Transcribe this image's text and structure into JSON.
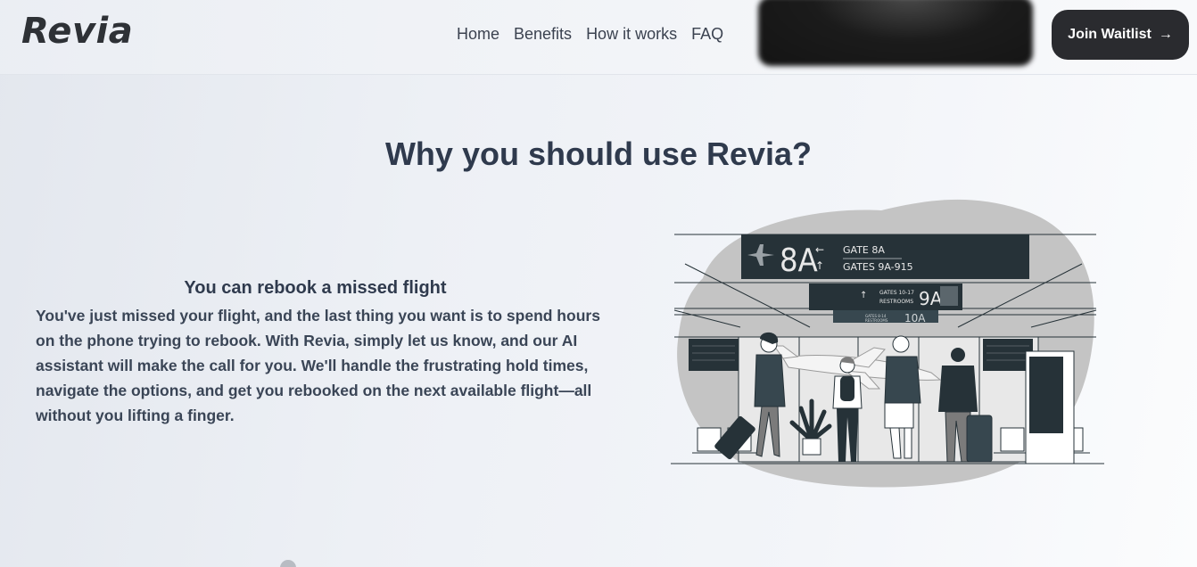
{
  "brand": {
    "logo_text": "Revia"
  },
  "nav": {
    "items": [
      {
        "label": "Home"
      },
      {
        "label": "Benefits"
      },
      {
        "label": "How it works"
      },
      {
        "label": "FAQ"
      }
    ],
    "cta_label": "Join Waitlist",
    "cta_icon": "arrow-right-icon"
  },
  "section": {
    "title": "Why you should use Revia?",
    "benefit": {
      "title": "You can rebook a missed flight",
      "body": "You've just missed your flight, and the last thing you want is to spend hours on the phone trying to rebook. With Revia, simply let us know, and our AI assistant will make the call for you. We'll handle the frustrating hold times, navigate the options, and get you rebooked on the next available flight—all without you lifting a finger."
    }
  },
  "illustration": {
    "sign_main": {
      "gate": "8A",
      "line1": "GATE 8A",
      "line2": "GATES 9A-915"
    },
    "sign_mid": {
      "gate": "9A",
      "line1": "GATES 10-17",
      "line2": "RESTROOMS"
    },
    "sign_back": {
      "gate": "10A",
      "line1": "GATES 8-14",
      "line2": "RESTROOMS"
    }
  },
  "colors": {
    "primary_text": "#2f3a4d",
    "button_bg": "#2a2b2f",
    "illustration_dark": "#263238",
    "illustration_blob": "#c4c4c4"
  }
}
